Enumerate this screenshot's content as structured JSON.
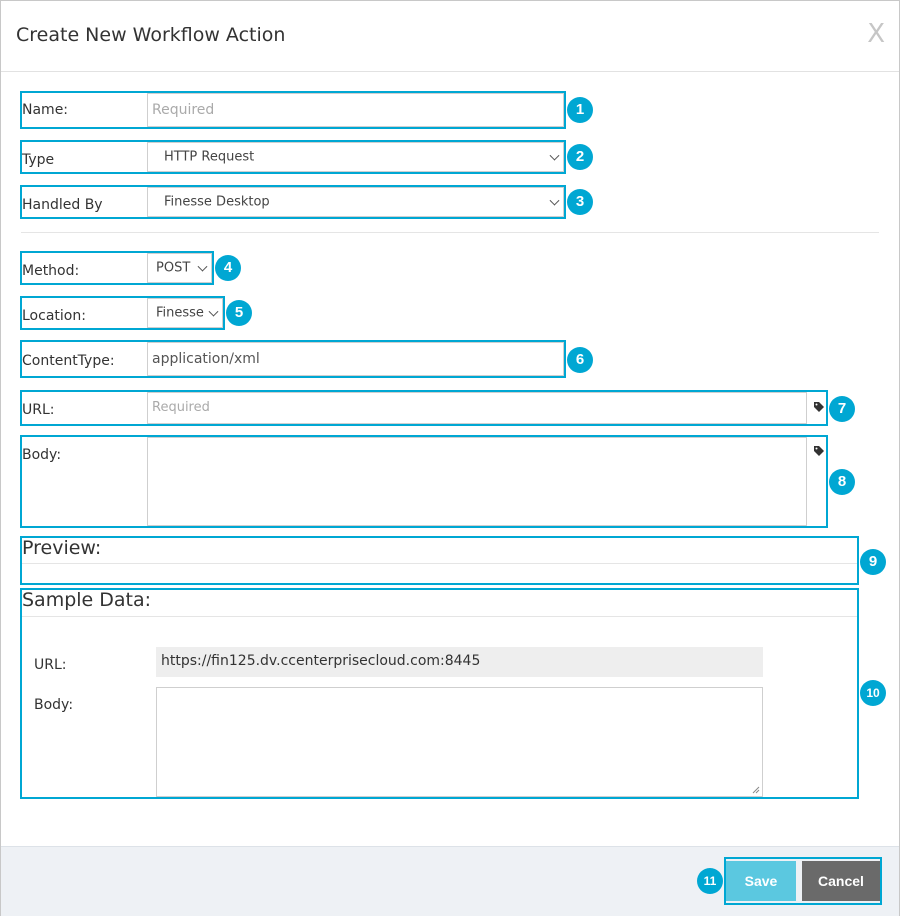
{
  "dialog": {
    "title": "Create New Workflow Action",
    "close_label": "X"
  },
  "form": {
    "name": {
      "label": "Name:",
      "placeholder": "Required",
      "value": ""
    },
    "type": {
      "label": "Type",
      "selected": "HTTP Request"
    },
    "handled_by": {
      "label": "Handled By",
      "selected": "Finesse Desktop"
    },
    "method": {
      "label": "Method:",
      "selected": "POST"
    },
    "location": {
      "label": "Location:",
      "selected": "Finesse"
    },
    "content_type": {
      "label": "ContentType:",
      "value": "application/xml"
    },
    "url": {
      "label": "URL:",
      "placeholder": "Required",
      "value": ""
    },
    "body": {
      "label": "Body:",
      "value": ""
    }
  },
  "preview": {
    "title": "Preview:"
  },
  "sample_data": {
    "title": "Sample Data:",
    "url_label": "URL:",
    "url_value": "https://fin125.dv.ccenterprisecloud.com:8445",
    "body_label": "Body:",
    "body_value": ""
  },
  "footer": {
    "save_label": "Save",
    "cancel_label": "Cancel"
  },
  "callouts": [
    "1",
    "2",
    "3",
    "4",
    "5",
    "6",
    "7",
    "8",
    "9",
    "10",
    "11"
  ],
  "colors": {
    "highlight": "#00a7d3",
    "save_button": "#5bc8e0",
    "cancel_button": "#6a6a6a",
    "footer_bg": "#eef1f5"
  },
  "icons": {
    "tag": "tag-icon",
    "close": "close-icon",
    "chevron": "chevron-down-icon"
  }
}
